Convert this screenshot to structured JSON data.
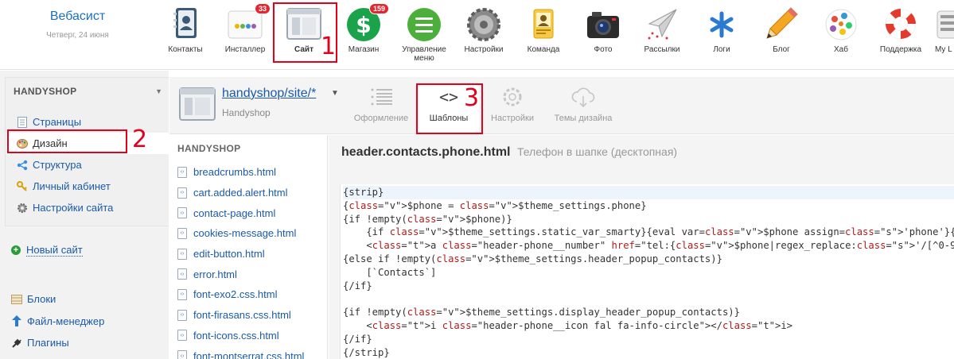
{
  "brand": {
    "name": "Вебасист",
    "date": "Четверг, 24 июня"
  },
  "apps": [
    {
      "label": "Контакты",
      "icon": "contacts-icon"
    },
    {
      "label": "Инсталлер",
      "icon": "installer-icon",
      "badge": "33"
    },
    {
      "label": "Сайт",
      "icon": "site-icon"
    },
    {
      "label": "Магазин",
      "icon": "shop-icon",
      "badge": "159"
    },
    {
      "label": "Управление меню",
      "icon": "menu-icon"
    },
    {
      "label": "Настройки",
      "icon": "settings-gear-icon"
    },
    {
      "label": "Команда",
      "icon": "team-icon"
    },
    {
      "label": "Фото",
      "icon": "camera-icon"
    },
    {
      "label": "Рассылки",
      "icon": "mailer-icon"
    },
    {
      "label": "Логи",
      "icon": "logs-icon"
    },
    {
      "label": "Блог",
      "icon": "pencil-icon"
    },
    {
      "label": "Хаб",
      "icon": "hub-icon"
    },
    {
      "label": "Поддержка",
      "icon": "lifebuoy-icon"
    },
    {
      "label": "My L",
      "icon": "mylang-icon"
    }
  ],
  "annotations": {
    "one": "1",
    "two": "2",
    "three": "3"
  },
  "sidebar": {
    "title": "HANDYSHOP",
    "items": [
      {
        "label": "Страницы",
        "icon": "pages-icon"
      },
      {
        "label": "Дизайн",
        "icon": "palette-icon"
      },
      {
        "label": "Структура",
        "icon": "structure-icon"
      },
      {
        "label": "Личный кабинет",
        "icon": "key-icon"
      },
      {
        "label": "Настройки сайта",
        "icon": "gear-icon"
      }
    ],
    "new_site": "Новый сайт",
    "tools": [
      {
        "label": "Блоки",
        "icon": "blocks-icon"
      },
      {
        "label": "Файл-менеджер",
        "icon": "upload-arrow-icon"
      },
      {
        "label": "Плагины",
        "icon": "plug-icon"
      }
    ]
  },
  "site": {
    "path": "handyshop/site/*",
    "name": "Handyshop"
  },
  "tabs": [
    {
      "label": "Оформление",
      "icon": "list-icon"
    },
    {
      "label": "Шаблоны",
      "icon": "code-brackets-icon"
    },
    {
      "label": "Настройки",
      "icon": "cog-icon"
    },
    {
      "label": "Темы дизайна",
      "icon": "cloud-download-icon"
    }
  ],
  "files": {
    "title": "HANDYSHOP",
    "items": [
      "breadcrumbs.html",
      "cart.added.alert.html",
      "contact-page.html",
      "cookies-message.html",
      "edit-button.html",
      "error.html",
      "font-exo2.css.html",
      "font-firasans.css.html",
      "font-icons.css.html",
      "font-montserrat.css.html"
    ]
  },
  "editor": {
    "filename": "header.contacts.phone.html",
    "description": "Телефон в шапке (десктопная)",
    "code": [
      "{strip}",
      "{$phone = $theme_settings.phone}",
      "{if !empty($phone)}",
      "    {if $theme_settings.static_var_smarty}{eval var=$phone assign='phone'}{/if}",
      "    <a class=\"header-phone__number\" href=\"tel:{$phone|regex_replace:'/[^0-9\\+]+/':''}\">{$phone}</a>",
      "{else if !empty($theme_settings.header_popup_contacts)}",
      "    [`Contacts`]",
      "{/if}",
      "",
      "{if !empty($theme_settings.display_header_popup_contacts)}",
      "    <i class=\"header-phone__icon fal fa-info-circle\"></i>",
      "{/if}",
      "{/strip}"
    ]
  }
}
